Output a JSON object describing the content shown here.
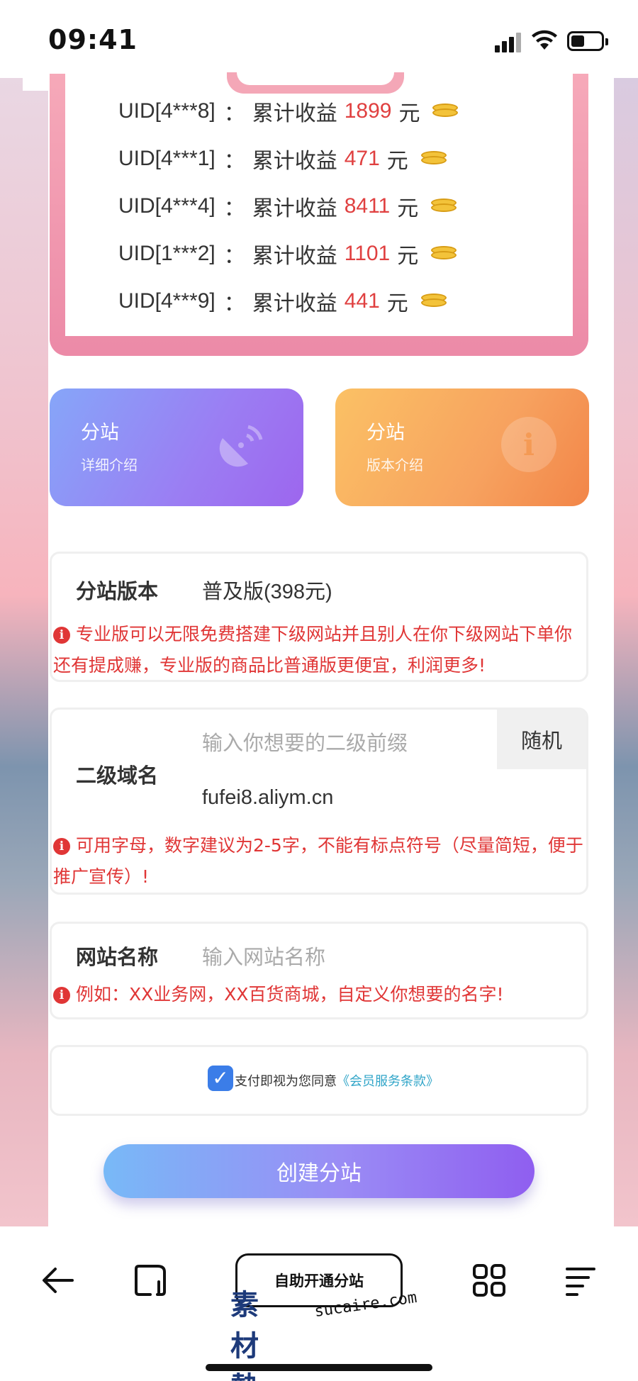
{
  "status_bar": {
    "time": "09:41"
  },
  "earnings": [
    {
      "uid": "UID[4***8]",
      "label": "累计收益",
      "amount": "1899",
      "unit": "元"
    },
    {
      "uid": "UID[4***1]",
      "label": "累计收益",
      "amount": "471",
      "unit": "元"
    },
    {
      "uid": "UID[4***4]",
      "label": "累计收益",
      "amount": "8411",
      "unit": "元"
    },
    {
      "uid": "UID[1***2]",
      "label": "累计收益",
      "amount": "1101",
      "unit": "元"
    },
    {
      "uid": "UID[4***9]",
      "label": "累计收益",
      "amount": "441",
      "unit": "元"
    }
  ],
  "earnings_separator": "：",
  "features": [
    {
      "title": "分站",
      "subtitle": "详细介绍",
      "icon": "satellite-dish-icon"
    },
    {
      "title": "分站",
      "subtitle": "版本介绍",
      "icon": "info-circle-icon"
    }
  ],
  "version": {
    "label": "分站版本",
    "value": "普及版(398元)",
    "hint": "专业版可以无限免费搭建下级网站并且别人在你下级网站下单你还有提成赚，专业版的商品比普通版更便宜，利润更多!"
  },
  "domain": {
    "label": "二级域名",
    "placeholder": "输入你想要的二级前缀",
    "random_button": "随机",
    "suffix": "fufei8.aliym.cn",
    "hint": "可用字母，数字建议为2-5字，不能有标点符号（尽量简短，便于推广宣传）!"
  },
  "site_name": {
    "label": "网站名称",
    "placeholder": "输入网站名称",
    "hint": "例如：XX业务网，XX百货商城，自定义你想要的名字!"
  },
  "agreement": {
    "checked": true,
    "text": "支付即视为您同意",
    "link": "《会员服务条款》"
  },
  "create_button": "创建分站",
  "bottom_bar": {
    "center_button": "自助开通分站",
    "icons": [
      "back-arrow-icon",
      "tab-square-icon",
      "grid-icon",
      "menu-icon"
    ]
  },
  "watermark": {
    "cn": "素材熱",
    "en": "sucaire.com"
  },
  "colors": {
    "accent_red": "#e03636",
    "amount_red": "#e04040",
    "link_teal": "#30a5c8",
    "checkbox_blue": "#3b7de8",
    "feature_purple": "#9b7df3",
    "feature_orange": "#f7a25f",
    "earnings_pink": "#ec8aa7"
  }
}
